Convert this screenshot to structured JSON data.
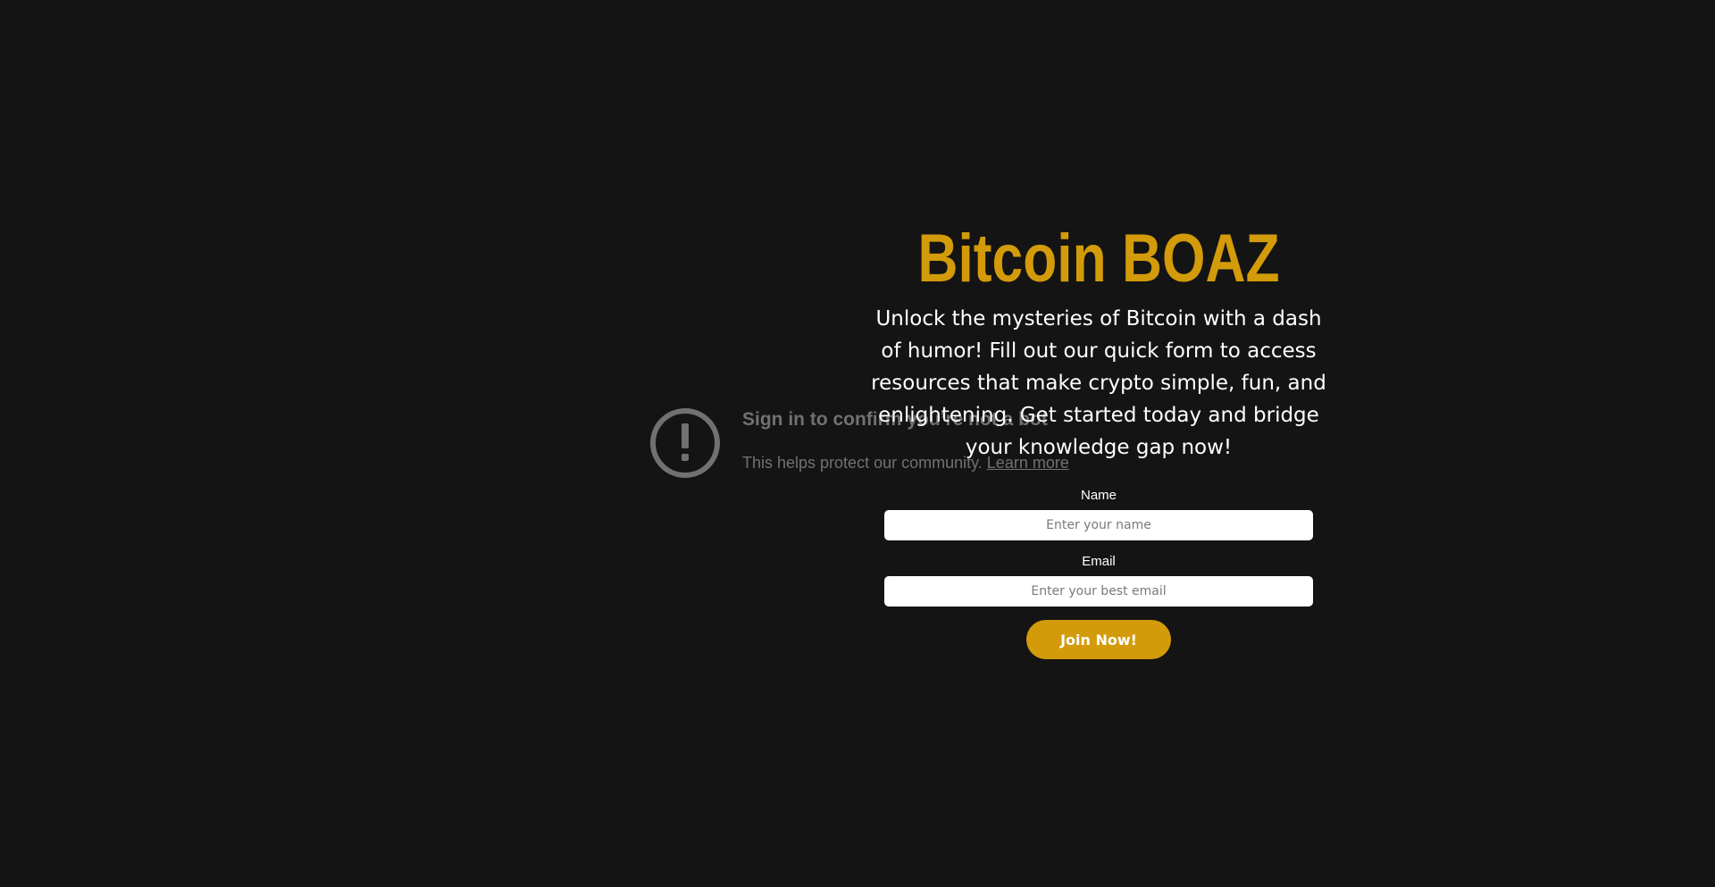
{
  "video_error": {
    "icon": "alert-circle-icon",
    "title": "Sign in to confirm you’re not a bot",
    "message": "This helps protect our community.",
    "link_label": "Learn more"
  },
  "hero": {
    "title": "Bitcoin BOAZ",
    "description": "Unlock the mysteries of Bitcoin with a dash of humor! Fill out our quick form to access resources that make crypto simple, fun, and enlightening. Get started today and bridge your knowledge gap now!"
  },
  "form": {
    "name_label": "Name",
    "name_placeholder": "Enter your name",
    "email_label": "Email",
    "email_placeholder": "Enter your best email",
    "submit_label": "Join Now!"
  },
  "colors": {
    "background": "#141414",
    "accent": "#d39b0a",
    "muted": "#717171"
  }
}
